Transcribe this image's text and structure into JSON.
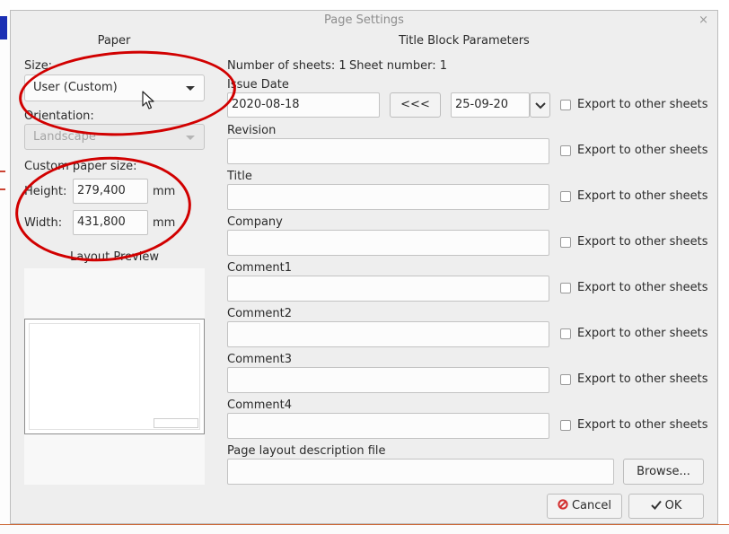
{
  "dialog": {
    "title": "Page Settings",
    "close_glyph": "×"
  },
  "paper": {
    "header": "Paper",
    "size_label": "Size:",
    "size_value": "User (Custom)",
    "orientation_label": "Orientation:",
    "orientation_value": "Landscape",
    "custom_label": "Custom paper size:",
    "height_label": "Height:",
    "height_value": "279,400",
    "height_unit": "mm",
    "width_label": "Width:",
    "width_value": "431,800",
    "width_unit": "mm",
    "preview_label": "Layout Preview"
  },
  "title_block": {
    "header": "Title Block Parameters",
    "num_sheets": "Number of sheets: 1",
    "sheet_number": "Sheet number: 1",
    "issue_date_label": "Issue Date",
    "issue_date_value": "2020-08-18",
    "date_copy_button": "<<<",
    "date_picker_value": "25-09-20",
    "export_label": "Export to other sheets",
    "fields": [
      {
        "label": "Revision",
        "value": ""
      },
      {
        "label": "Title",
        "value": ""
      },
      {
        "label": "Company",
        "value": ""
      },
      {
        "label": "Comment1",
        "value": ""
      },
      {
        "label": "Comment2",
        "value": ""
      },
      {
        "label": "Comment3",
        "value": ""
      },
      {
        "label": "Comment4",
        "value": ""
      }
    ],
    "layout_file_label": "Page layout description file",
    "layout_file_value": "",
    "browse_button": "Browse..."
  },
  "buttons": {
    "cancel": "Cancel",
    "ok": "OK"
  },
  "colors": {
    "annotation": "#d10000",
    "dialog_bg": "#eeeeee",
    "cancel_icon": "#d32f2f"
  }
}
